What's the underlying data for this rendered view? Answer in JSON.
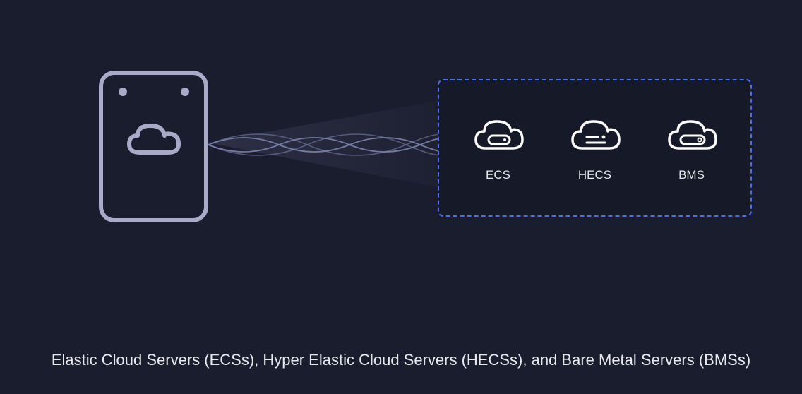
{
  "diagram": {
    "caption": "Elastic Cloud Servers (ECSs), Hyper Elastic Cloud Servers (HECSs), and Bare Metal Servers (BMSs)",
    "services": [
      {
        "label": "ECS",
        "iconName": "cloud-server-ecs-icon"
      },
      {
        "label": "HECS",
        "iconName": "cloud-server-hecs-icon"
      },
      {
        "label": "BMS",
        "iconName": "cloud-server-bms-icon"
      }
    ],
    "colors": {
      "background": "#1a1d2e",
      "cardBorder": "#a8abc7",
      "dashBorder": "#4a6cf7",
      "text": "#e8e9ed"
    }
  }
}
